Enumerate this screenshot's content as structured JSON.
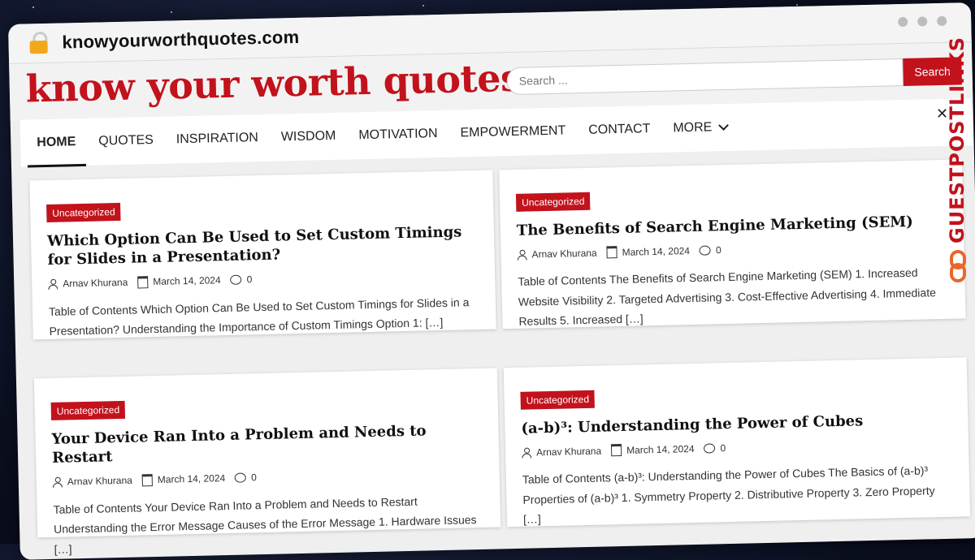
{
  "browser": {
    "url": "knowyourworthquotes.com"
  },
  "header": {
    "site_title": "know your worth quotes",
    "search_placeholder": "Search ...",
    "search_button": "Search"
  },
  "nav": {
    "items": [
      "HOME",
      "QUOTES",
      "INSPIRATION",
      "WISDOM",
      "MOTIVATION",
      "EMPOWERMENT",
      "CONTACT",
      "MORE"
    ]
  },
  "posts": [
    {
      "category": "Uncategorized",
      "title": "Which Option Can Be Used to Set Custom Timings for Slides in a Presentation?",
      "author": "Arnav Khurana",
      "date": "March 14, 2024",
      "comments": "0",
      "excerpt": "Table of Contents Which Option Can Be Used to Set Custom Timings for Slides in a Presentation? Understanding the Importance of Custom Timings Option 1: […]"
    },
    {
      "category": "Uncategorized",
      "title": "The Benefits of Search Engine Marketing (SEM)",
      "author": "Arnav Khurana",
      "date": "March 14, 2024",
      "comments": "0",
      "excerpt": "Table of Contents The Benefits of Search Engine Marketing (SEM) 1. Increased Website Visibility 2. Targeted Advertising 3. Cost-Effective Advertising 4. Immediate Results 5. Increased […]"
    },
    {
      "category": "Uncategorized",
      "title": "Your Device Ran Into a Problem and Needs to Restart",
      "author": "Arnav Khurana",
      "date": "March 14, 2024",
      "comments": "0",
      "excerpt": "Table of Contents Your Device Ran Into a Problem and Needs to Restart Understanding the Error Message Causes of the Error Message 1. Hardware Issues […]"
    },
    {
      "category": "Uncategorized",
      "title": "(a-b)³: Understanding the Power of Cubes",
      "author": "Arnav Khurana",
      "date": "March 14, 2024",
      "comments": "0",
      "excerpt": "Table of Contents (a-b)³: Understanding the Power of Cubes The Basics of (a-b)³ Properties of (a-b)³ 1. Symmetry Property 2. Distributive Property 3. Zero Property […]"
    }
  ],
  "watermark": {
    "text": "GUESTPOSTLINKS",
    "color": "#c2121c"
  },
  "colors": {
    "accent": "#c2121c",
    "lock": "#f2a81d"
  },
  "icons": [
    "lock-icon",
    "user-icon",
    "calendar-icon",
    "comment-icon",
    "chevron-down-icon",
    "close-icon"
  ]
}
